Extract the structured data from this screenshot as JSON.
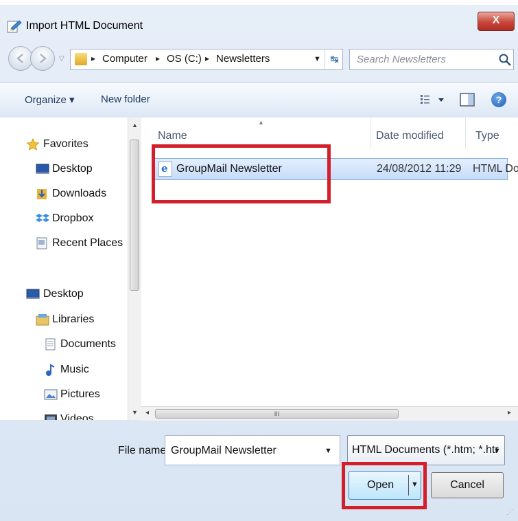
{
  "window": {
    "title": "Import HTML Document",
    "close_label": "X"
  },
  "address": {
    "crumbs": [
      "Computer",
      "OS (C:)",
      "Newsletters"
    ],
    "search_placeholder": "Search Newsletters"
  },
  "toolbar": {
    "organize_label": "Organize ▾",
    "new_folder_label": "New folder"
  },
  "nav": {
    "favorites": {
      "label": "Favorites",
      "items": [
        "Desktop",
        "Downloads",
        "Dropbox",
        "Recent Places"
      ]
    },
    "desktop": {
      "label": "Desktop"
    },
    "libraries": {
      "label": "Libraries",
      "items": [
        "Documents",
        "Music",
        "Pictures",
        "Videos"
      ]
    }
  },
  "file_list": {
    "columns": [
      "Name",
      "Date modified",
      "Type"
    ],
    "rows": [
      {
        "name": "GroupMail Newsletter",
        "date": "24/08/2012 11:29",
        "type": "HTML Do"
      }
    ]
  },
  "footer": {
    "file_name_label": "File name:",
    "file_name_value": "GroupMail Newsletter",
    "file_type_value": "HTML Documents (*.htm; *.htr",
    "open_label": "Open",
    "cancel_label": "Cancel"
  },
  "colors": {
    "highlight": "#d21f2b",
    "selection": "#c6dcf8",
    "accent": "#1e395b"
  }
}
